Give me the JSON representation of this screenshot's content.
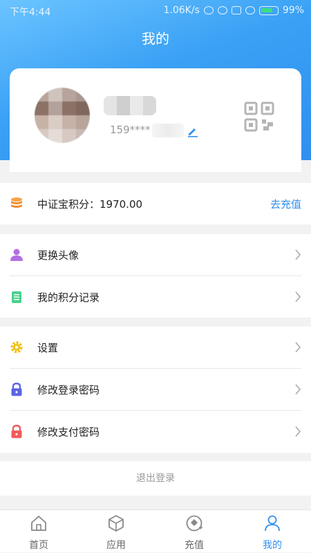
{
  "status_bar": {
    "time": "下午4:44",
    "net_speed": "1.06K/s",
    "battery": "99%"
  },
  "page_title": "我的",
  "profile": {
    "phone": "159****"
  },
  "points": {
    "label": "中证宝积分：1970.00",
    "action": "去充值"
  },
  "menu_group1": [
    {
      "label": "更换头像",
      "icon": "person-icon"
    },
    {
      "label": "我的积分记录",
      "icon": "clipboard-icon"
    }
  ],
  "menu_group2": [
    {
      "label": "设置",
      "icon": "gear-icon"
    },
    {
      "label": "修改登录密码",
      "icon": "lock-icon"
    },
    {
      "label": "修改支付密码",
      "icon": "lock-icon"
    }
  ],
  "logout_label": "退出登录",
  "tabs": [
    {
      "label": "首页",
      "icon": "home-icon"
    },
    {
      "label": "应用",
      "icon": "cube-icon"
    },
    {
      "label": "充值",
      "icon": "recharge-icon"
    },
    {
      "label": "我的",
      "icon": "user-icon"
    }
  ],
  "colors": {
    "accent": "#2f8ff0",
    "header": "#3aa1f5"
  }
}
